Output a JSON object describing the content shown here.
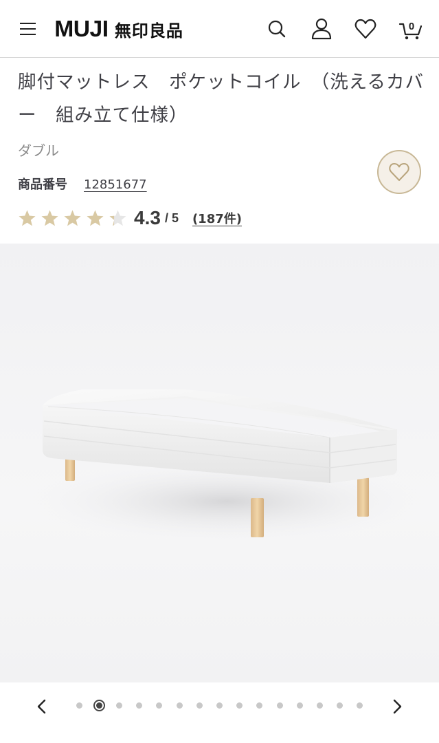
{
  "header": {
    "logo_en": "MUJI",
    "logo_jp": "無印良品",
    "cart_count": "0",
    "icons": [
      "menu-icon",
      "search-icon",
      "account-icon",
      "heart-icon",
      "cart-icon"
    ]
  },
  "product": {
    "title": "脚付マットレス　ポケットコイル　（洗えるカバー　組み立て仕様）",
    "variant": "ダブル",
    "sku_label": "商品番号",
    "sku_value": "12851677",
    "rating": "4.3",
    "rating_max": "/ 5",
    "rating_fraction": 0.86,
    "review_count": "(187件)"
  },
  "carousel": {
    "total_images": 15,
    "active_index": 1
  },
  "colors": {
    "star_fill": "#d9c9a3",
    "star_empty": "#e6e6e6",
    "fav_bg": "#f5f0e8",
    "fav_border": "#c8b896"
  }
}
